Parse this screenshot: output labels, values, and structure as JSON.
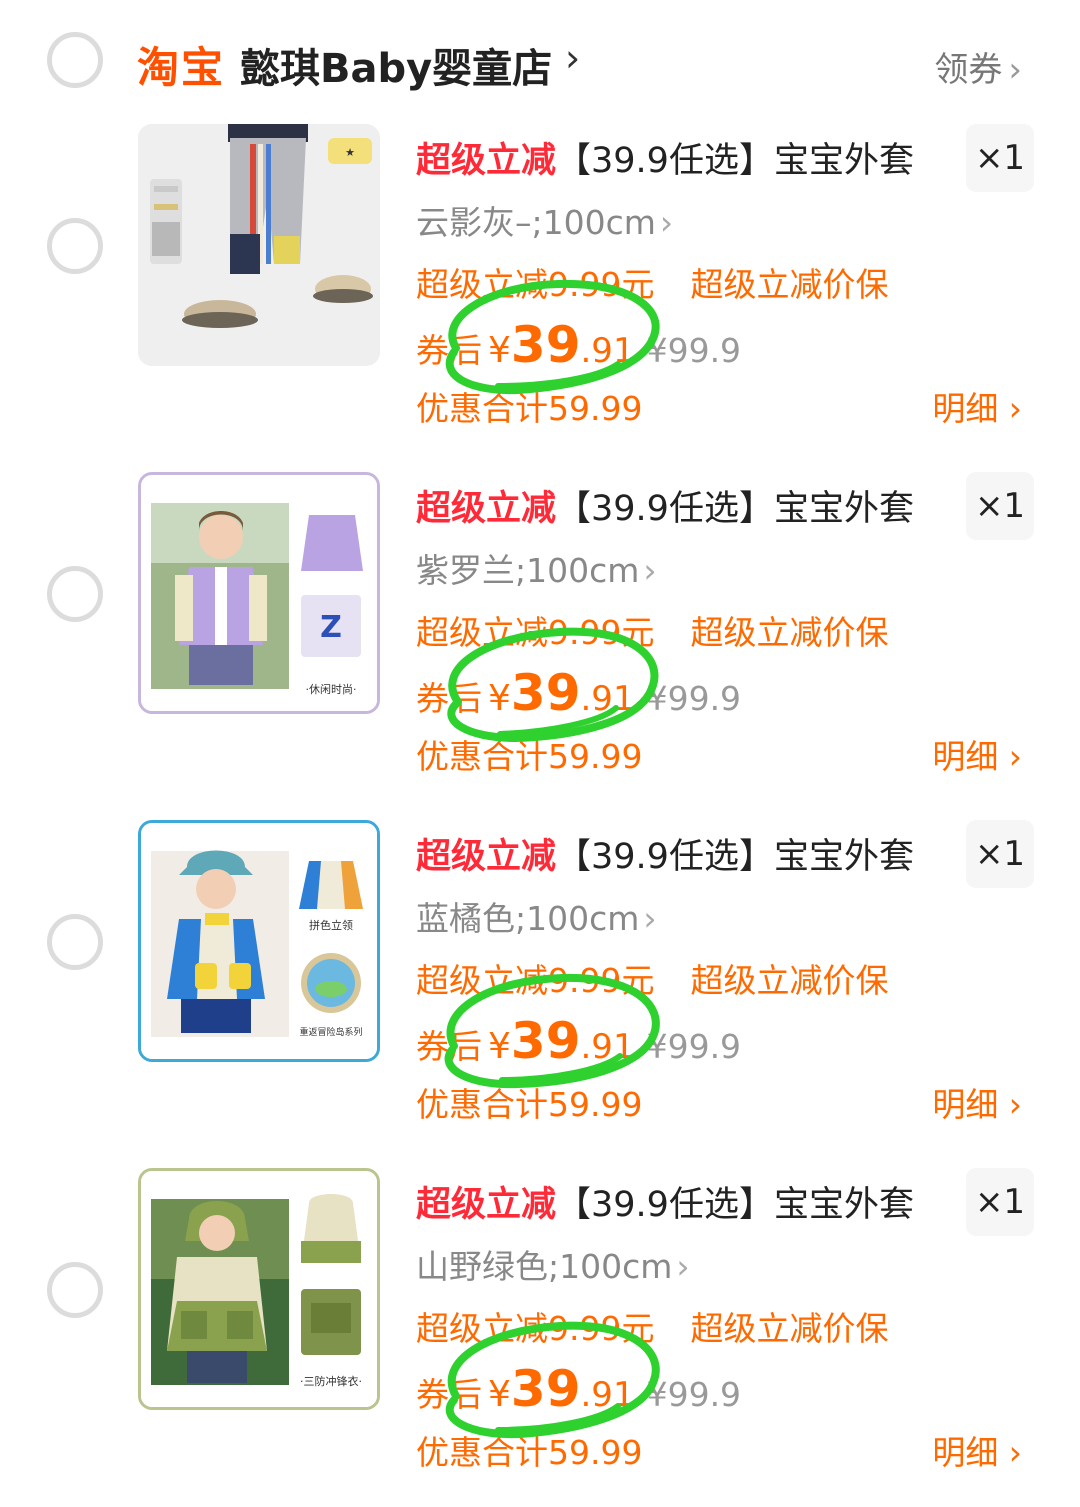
{
  "shop": {
    "brand": "淘宝",
    "name": "懿琪Baby婴童店",
    "arrow": "›",
    "coupon_label": "领券",
    "coupon_arrow": "›"
  },
  "items": [
    {
      "promo_tag": "超级立减",
      "title": "【39.9任选】宝宝外套",
      "qty": "×1",
      "sku": "云影灰–;100cm",
      "sku_arrow": "›",
      "promo_amount": "超级立减9.99元",
      "promo_guarantee": "超级立减价保",
      "price_label": "券后",
      "price_yen": "¥",
      "price_int": "39",
      "price_dec": ".91",
      "orig_price": "¥99.9",
      "total": "优惠合计59.99",
      "detail": "明细 ›"
    },
    {
      "promo_tag": "超级立减",
      "title": "【39.9任选】宝宝外套",
      "qty": "×1",
      "sku": "紫罗兰;100cm",
      "sku_arrow": "›",
      "promo_amount": "超级立减9.99元",
      "promo_guarantee": "超级立减价保",
      "price_label": "券后",
      "price_yen": "¥",
      "price_int": "39",
      "price_dec": ".91",
      "orig_price": "¥99.9",
      "total": "优惠合计59.99",
      "detail": "明细 ›"
    },
    {
      "promo_tag": "超级立减",
      "title": "【39.9任选】宝宝外套",
      "qty": "×1",
      "sku": "蓝橘色;100cm",
      "sku_arrow": "›",
      "promo_amount": "超级立减9.99元",
      "promo_guarantee": "超级立减价保",
      "price_label": "券后",
      "price_yen": "¥",
      "price_int": "39",
      "price_dec": ".91",
      "orig_price": "¥99.9",
      "total": "优惠合计59.99",
      "detail": "明细 ›"
    },
    {
      "promo_tag": "超级立减",
      "title": "【39.9任选】宝宝外套",
      "qty": "×1",
      "sku": "山野绿色;100cm",
      "sku_arrow": "›",
      "promo_amount": "超级立减9.99元",
      "promo_guarantee": "超级立减价保",
      "price_label": "券后",
      "price_yen": "¥",
      "price_int": "39",
      "price_dec": ".91",
      "orig_price": "¥99.9",
      "total": "优惠合计59.99",
      "detail": "明细 ›"
    }
  ],
  "thumbnail_captions": [
    "",
    "·休闲时尚·",
    "拼色立领",
    "重返冒险岛系列",
    "·三防冲锋衣·"
  ],
  "colors": {
    "accent_orange": "#ff6a00",
    "brand_orange": "#ff5000",
    "promo_red": "#ff2a38",
    "annotation_green": "#2fd12f",
    "muted_gray": "#888888"
  }
}
